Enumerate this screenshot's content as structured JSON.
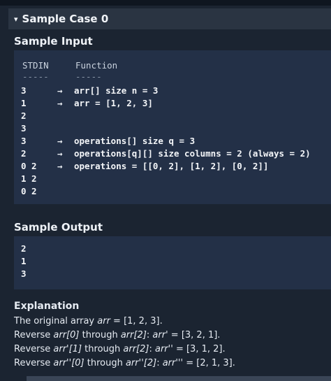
{
  "case": {
    "caret": "▾",
    "title": "Sample Case 0"
  },
  "input": {
    "title": "Sample Input",
    "stdin_header": "STDIN",
    "function_header": "Function",
    "dash": "-----",
    "stdin": [
      "3",
      "1",
      "2",
      "3",
      "3",
      "2",
      "0 2",
      "1 2",
      "0 2"
    ],
    "arrow": "→",
    "functions": [
      "arr[] size n = 3",
      "arr = [1, 2, 3]",
      "operations[] size q = 3",
      "operations[q][] size columns = 2 (always = 2)",
      "operations = [[0, 2], [1, 2], [0, 2]]"
    ]
  },
  "output": {
    "title": "Sample Output",
    "values": [
      "2",
      "1",
      "3"
    ]
  },
  "explanation": {
    "title": "Explanation",
    "lines": [
      [
        "The original array ",
        "arr",
        " = [1, 2, 3]."
      ],
      [
        "Reverse ",
        "arr[0]",
        " through ",
        "arr[2]",
        ": ",
        "arr'",
        " = [3, 2, 1]."
      ],
      [
        "Reverse ",
        "arr'[1]",
        " through ",
        "arr[2]",
        ": ",
        "arr''",
        " = [3, 1, 2]."
      ],
      [
        "Reverse ",
        "arr''[0]",
        " through ",
        "arr''[2]",
        ": ",
        "arr'''",
        " = [2, 1, 3]."
      ]
    ]
  }
}
